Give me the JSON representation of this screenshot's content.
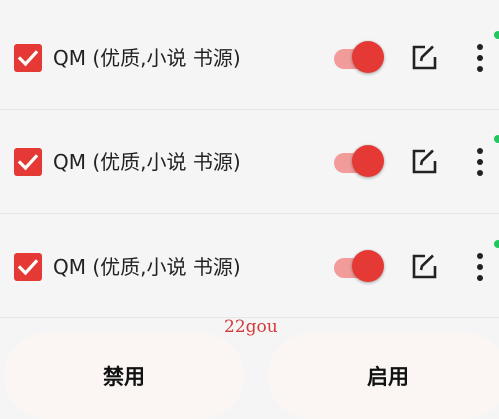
{
  "colors": {
    "accent": "#e53935",
    "track": "#f19c9a",
    "online": "#22c55e"
  },
  "sources": [
    {
      "name": "QM (优质,小说 书源)",
      "checked": true,
      "enabled": true
    },
    {
      "name": "QM (优质,小说 书源)",
      "checked": true,
      "enabled": true
    },
    {
      "name": "QM (优质,小说 书源)",
      "checked": true,
      "enabled": true
    }
  ],
  "icons": {
    "checkbox": "check-icon",
    "edit": "edit-icon",
    "more": "more-vertical-icon"
  },
  "watermark": "22gou",
  "actions": {
    "disable_label": "禁用",
    "enable_label": "启用"
  }
}
